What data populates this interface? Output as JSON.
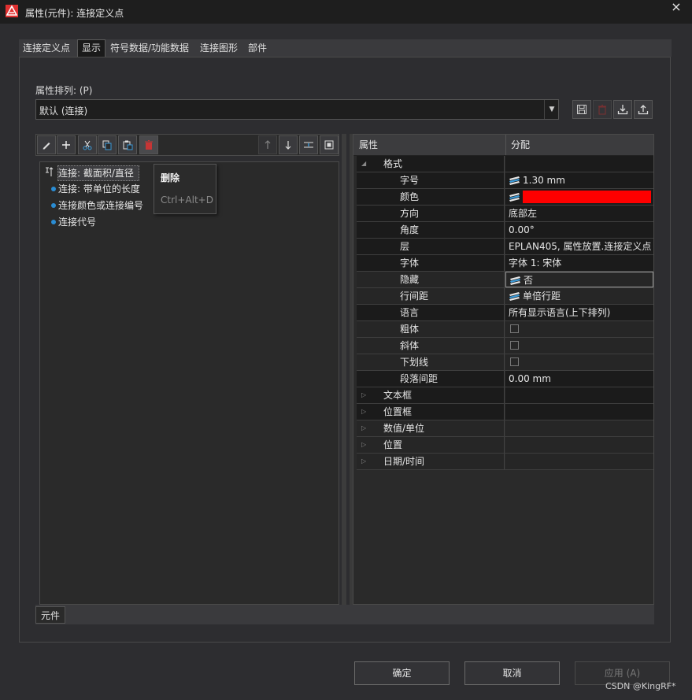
{
  "window": {
    "title": "属性(元件): 连接定义点",
    "close_label": "×"
  },
  "tabs": [
    {
      "label": "连接定义点"
    },
    {
      "label": "显示"
    },
    {
      "label": "符号数据/功能数据"
    },
    {
      "label": "连接图形"
    },
    {
      "label": "部件"
    }
  ],
  "sort": {
    "label": "属性排列: (P)",
    "value": "默认 (连接)"
  },
  "list": {
    "items": [
      {
        "label": "连接: 截面积/直径"
      },
      {
        "label": "连接: 带单位的长度"
      },
      {
        "label": "连接颜色或连接编号"
      },
      {
        "label": "连接代号"
      }
    ]
  },
  "context_menu": {
    "delete": "删除",
    "shortcut": "Ctrl+Alt+D"
  },
  "grid": {
    "col_property": "属性",
    "col_value": "分配",
    "rows": [
      {
        "name": "格式",
        "value": ""
      },
      {
        "name": "字号",
        "value": "1.30 mm"
      },
      {
        "name": "颜色",
        "value": ""
      },
      {
        "name": "方向",
        "value": "底部左"
      },
      {
        "name": "角度",
        "value": "0.00°"
      },
      {
        "name": "层",
        "value": "EPLAN405, 属性放置.连接定义点"
      },
      {
        "name": "字体",
        "value": "字体 1: 宋体"
      },
      {
        "name": "隐藏",
        "value": "否"
      },
      {
        "name": "行间距",
        "value": "单倍行距"
      },
      {
        "name": "语言",
        "value": "所有显示语言(上下排列)"
      },
      {
        "name": "粗体",
        "value": ""
      },
      {
        "name": "斜体",
        "value": ""
      },
      {
        "name": "下划线",
        "value": ""
      },
      {
        "name": "段落间距",
        "value": "0.00 mm"
      },
      {
        "name": "文本框",
        "value": ""
      },
      {
        "name": "位置框",
        "value": ""
      },
      {
        "name": "数值/单位",
        "value": ""
      },
      {
        "name": "位置",
        "value": ""
      },
      {
        "name": "日期/时间",
        "value": ""
      }
    ]
  },
  "bottom_tab": "元件",
  "buttons": {
    "ok": "确定",
    "cancel": "取消",
    "apply": "应用 (A)"
  },
  "watermark": "CSDN @KingRF*",
  "colors": {
    "accent_red": "#ff0000",
    "delete_icon": "#d23a3a",
    "bullet": "#2a8dd4"
  }
}
